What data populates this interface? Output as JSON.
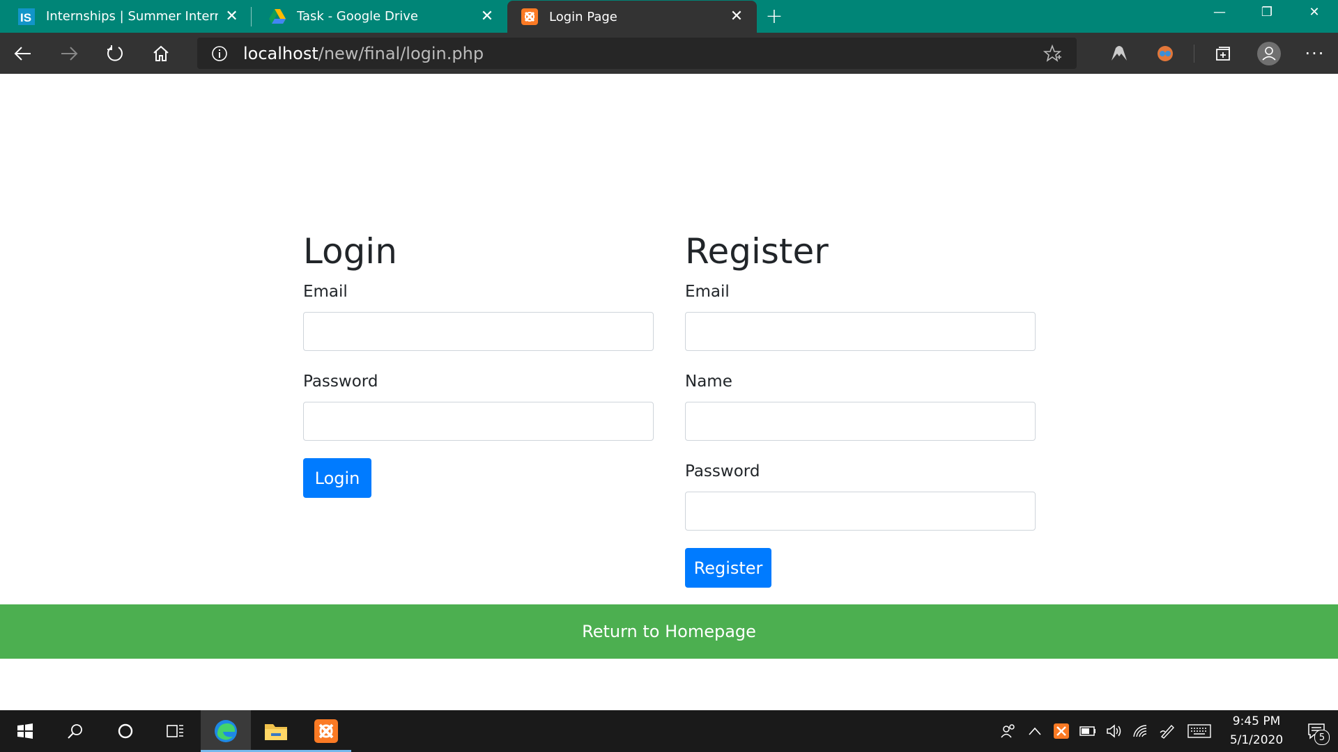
{
  "browser": {
    "tabs": [
      {
        "title": "Internships | Summer Internship",
        "favicon": "internshala-icon"
      },
      {
        "title": "Task - Google Drive",
        "favicon": "google-drive-icon"
      },
      {
        "title": "Login Page",
        "favicon": "xampp-icon",
        "active": true
      }
    ],
    "address": {
      "host": "localhost",
      "path": "/new/final/login.php"
    }
  },
  "login": {
    "heading": "Login",
    "email_label": "Email",
    "email_value": "",
    "password_label": "Password",
    "password_value": "",
    "button": "Login"
  },
  "register": {
    "heading": "Register",
    "email_label": "Email",
    "email_value": "",
    "name_label": "Name",
    "name_value": "",
    "password_label": "Password",
    "password_value": "",
    "button": "Register"
  },
  "footer": {
    "home_link": "Return to Homepage"
  },
  "taskbar": {
    "time": "9:45 PM",
    "date": "5/1/2020",
    "notifications": "5"
  },
  "colors": {
    "tab_strip": "#008577",
    "primary_button": "#007bff",
    "home_bar": "#4caf50"
  }
}
